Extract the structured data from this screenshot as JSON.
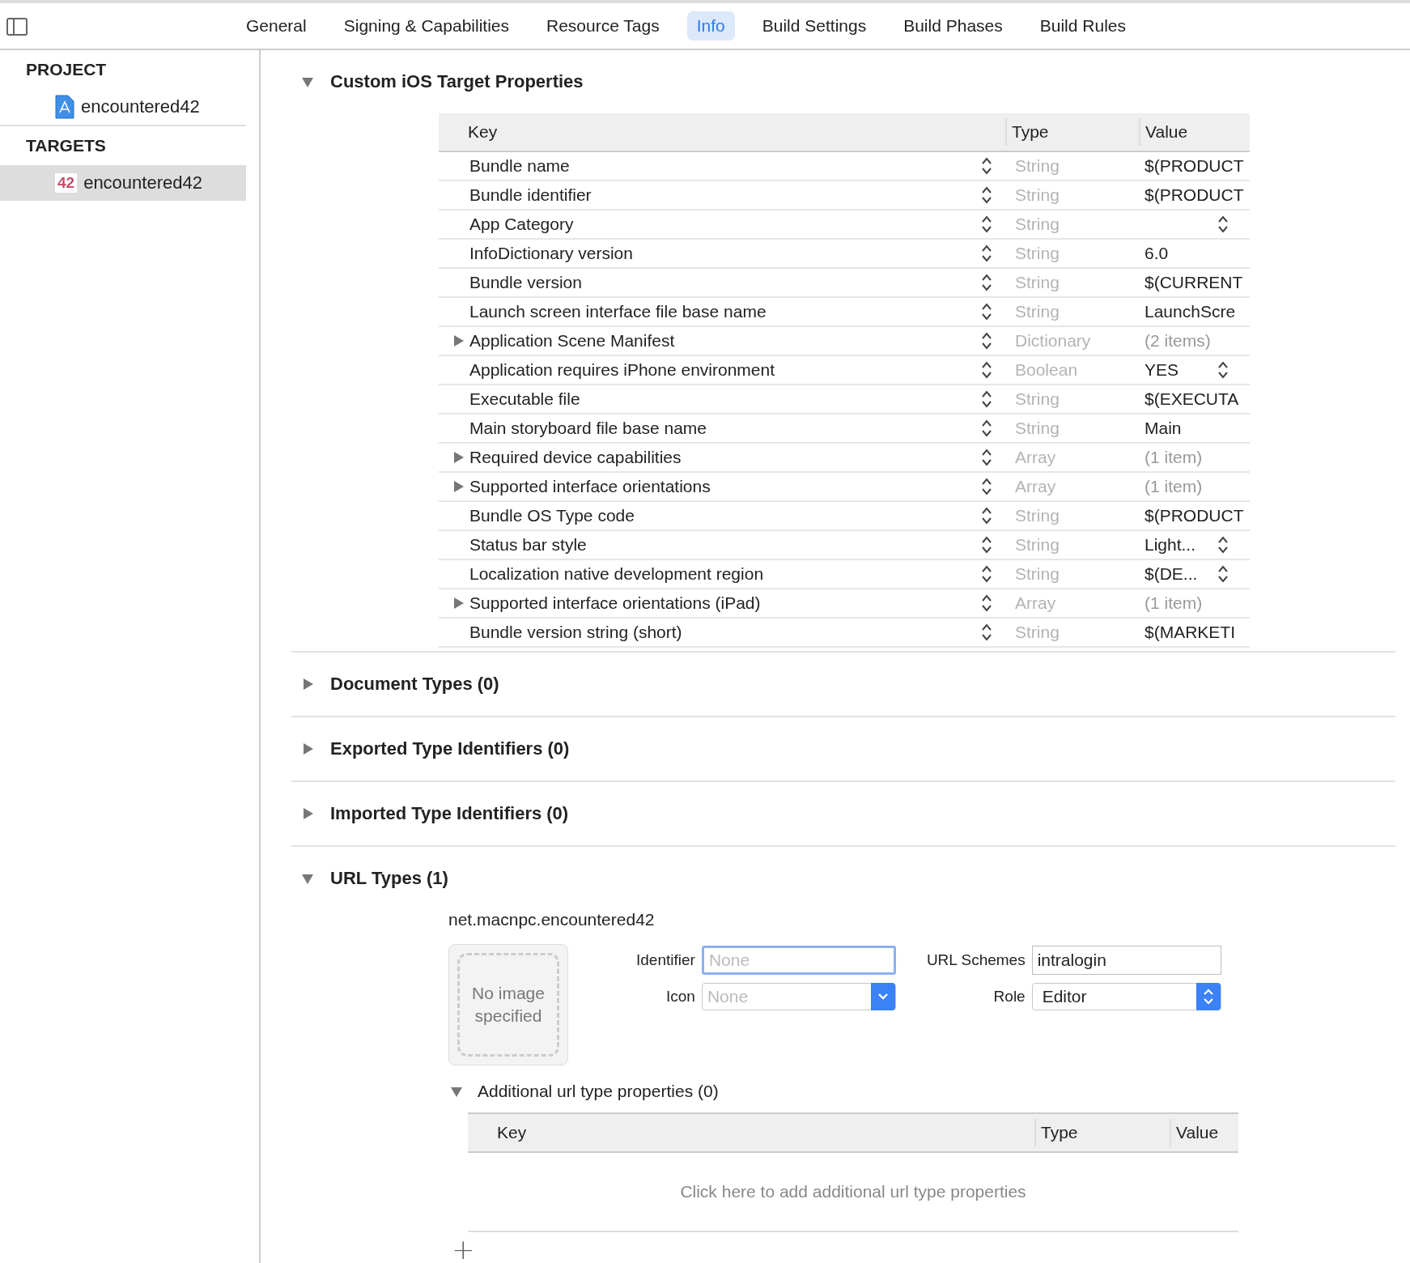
{
  "tabs": [
    {
      "label": "General",
      "selected": false
    },
    {
      "label": "Signing & Capabilities",
      "selected": false
    },
    {
      "label": "Resource Tags",
      "selected": false
    },
    {
      "label": "Info",
      "selected": true
    },
    {
      "label": "Build Settings",
      "selected": false
    },
    {
      "label": "Build Phases",
      "selected": false
    },
    {
      "label": "Build Rules",
      "selected": false
    }
  ],
  "sidebar": {
    "groups": [
      {
        "title": "PROJECT",
        "items": [
          {
            "label": "encountered42",
            "kind": "project",
            "selected": false
          }
        ]
      },
      {
        "title": "TARGETS",
        "items": [
          {
            "label": "encountered42",
            "kind": "target",
            "badge": "42",
            "selected": true
          }
        ]
      }
    ]
  },
  "sections": [
    {
      "title": "Custom iOS Target Properties",
      "expanded": true,
      "kind": "properties",
      "columns": [
        "Key",
        "Type",
        "Value"
      ],
      "rows": [
        {
          "key": "Bundle name",
          "type": "String",
          "value": "$(PRODUCT",
          "expandable": false,
          "popup": false
        },
        {
          "key": "Bundle identifier",
          "type": "String",
          "value": "$(PRODUCT",
          "expandable": false,
          "popup": false
        },
        {
          "key": "App Category",
          "type": "String",
          "expandable": false,
          "popup": true
        },
        {
          "key": "InfoDictionary version",
          "type": "String",
          "value": "6.0",
          "expandable": false,
          "popup": false
        },
        {
          "key": "Bundle version",
          "type": "String",
          "value": "$(CURRENT",
          "expandable": false,
          "popup": false
        },
        {
          "key": "Launch screen interface file base name",
          "type": "String",
          "value": "LaunchScre",
          "expandable": false,
          "popup": false
        },
        {
          "key": "Application Scene Manifest",
          "type": "Dictionary",
          "value": "(2 items)",
          "expandable": true,
          "popup": false
        },
        {
          "key": "Application requires iPhone environment",
          "type": "Boolean",
          "value": "YES",
          "expandable": false,
          "popup": true
        },
        {
          "key": "Executable file",
          "type": "String",
          "value": "$(EXECUTA",
          "expandable": false,
          "popup": false
        },
        {
          "key": "Main storyboard file base name",
          "type": "String",
          "value": "Main",
          "expandable": false,
          "popup": false
        },
        {
          "key": "Required device capabilities",
          "type": "Array",
          "value": "(1 item)",
          "expandable": true,
          "popup": false
        },
        {
          "key": "Supported interface orientations",
          "type": "Array",
          "value": "(1 item)",
          "expandable": true,
          "popup": false
        },
        {
          "key": "Bundle OS Type code",
          "type": "String",
          "value": "$(PRODUCT",
          "expandable": false,
          "popup": false
        },
        {
          "key": "Status bar style",
          "type": "String",
          "value": "Light...",
          "expandable": false,
          "popup": true
        },
        {
          "key": "Localization native development region",
          "type": "String",
          "value": "$(DE...",
          "expandable": false,
          "popup": true
        },
        {
          "key": "Supported interface orientations (iPad)",
          "type": "Array",
          "value": "(1 item)",
          "expandable": true,
          "popup": false
        },
        {
          "key": "Bundle version string (short)",
          "type": "String",
          "value": "$(MARKETI",
          "expandable": false,
          "popup": false
        }
      ]
    },
    {
      "title": "Document Types (0)",
      "expanded": false,
      "kind": "plain"
    },
    {
      "title": "Exported Type Identifiers (0)",
      "expanded": false,
      "kind": "plain"
    },
    {
      "title": "Imported Type Identifiers (0)",
      "expanded": false,
      "kind": "plain"
    },
    {
      "title": "URL Types (1)",
      "expanded": true,
      "kind": "url_types",
      "entry": {
        "name": "net.macnpc.encountered42",
        "image_text": "No image specified",
        "identifier": {
          "label": "Identifier",
          "placeholder": "None",
          "focused": true
        },
        "icon": {
          "label": "Icon",
          "placeholder": "None"
        },
        "url_schemes": {
          "label": "URL Schemes",
          "value": "intralogin"
        },
        "role": {
          "label": "Role",
          "value": "Editor"
        },
        "additional": {
          "title": "Additional url type properties (0)",
          "expanded": true,
          "columns": [
            "Key",
            "Type",
            "Value"
          ],
          "empty_text": "Click here to add additional url type properties",
          "add": "+"
        }
      }
    }
  ]
}
